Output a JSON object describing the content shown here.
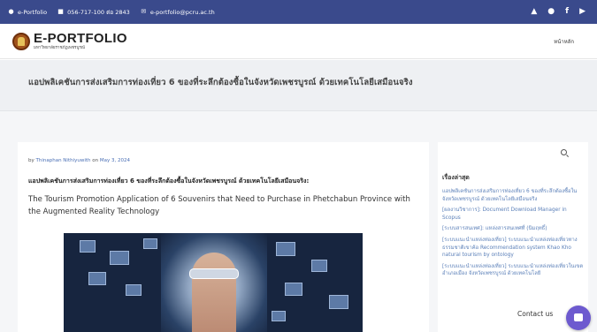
{
  "topbar": {
    "site": "e-Portfolio",
    "phone": "056-717-100 ต่อ 2843",
    "email": "e-portfolio@pcru.ac.th",
    "social_icons": [
      "graduation-cap-icon",
      "chat-icon",
      "facebook-icon",
      "youtube-icon"
    ]
  },
  "header": {
    "logo_title": "E-PORTFOLIO",
    "logo_subtitle": "มหาวิทยาลัยราชภัฏเพชรบูรณ์",
    "nav_home": "หน้าหลัก"
  },
  "title_band": {
    "title": "แอปพลิเคชันการส่งเสริมการท่องเที่ยว 6 ของที่ระลึกต้องซื้อในจังหวัดเพชรบูรณ์ ด้วยเทคโนโลยีเสมือนจริง"
  },
  "post": {
    "by": "by",
    "author": "Thinaphan Nithiyuwith",
    "on": "on",
    "date": "May 3, 2024",
    "title_th": "แอปพลิเคชันการส่งเสริมการท่องเที่ยว 6 ของที่ระลึกต้องซื้อในจังหวัดเพชรบูรณ์ ด้วยเทคโนโลยีเสมือนจริง:",
    "title_en": "The Tourism Promotion Application of 6 Souvenirs that Need to Purchase in Phetchabun Province with the Augmented Reality Technology"
  },
  "sidebar": {
    "heading": "เรื่องล่าสุด",
    "items": [
      "แอปพลิเคชันการส่งเสริมการท่องเที่ยว 6 ของที่ระลึกต้องซื้อในจังหวัดเพชรบูรณ์ ด้วยเทคโนโลยีเสมือนจริง",
      "[ผลงานวิชาการ]: Document Download Manager in Scopus",
      "[ระบบสารสนเทศ]: แหล่งสารสนเทศที่ (นิมฤทธิ์)",
      "[ระบบแนะนำแหล่งท่องเที่ยว] ระบบแนะนำแหล่งท่องเที่ยวทางธรรมชาติเขาค้อ Recommendation system Khao Kho natural tourism by ontology",
      "[ระบบแนะนำแหล่งท่องเที่ยว] ระบบแนะนำแหล่งท่องเที่ยวในเขตอำเภอเมือง จังหวัดเพชรบูรณ์ ด้วยเทคโนโลยี"
    ]
  },
  "widget": {
    "contact_label": "Contact us"
  },
  "colors": {
    "topbar": "#3a4a8c",
    "link": "#5a7fb8",
    "chat": "#6d5acf"
  }
}
